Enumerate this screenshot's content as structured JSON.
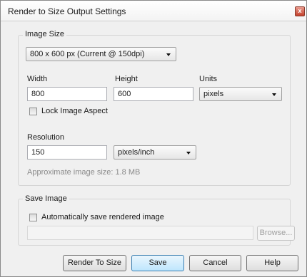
{
  "window": {
    "title": "Render to Size Output Settings",
    "close_glyph": "x"
  },
  "image_size": {
    "group_label": "Image Size",
    "preset_selected": "800 x 600 px (Current @ 150dpi)",
    "width_label": "Width",
    "width_value": "800",
    "height_label": "Height",
    "height_value": "600",
    "units_label": "Units",
    "units_selected": "pixels",
    "lock_aspect_label": "Lock Image Aspect",
    "lock_aspect_checked": false,
    "resolution_label": "Resolution",
    "resolution_value": "150",
    "resolution_unit_selected": "pixels/inch",
    "approx_size_text": "Approximate image size: 1.8 MB"
  },
  "save_image": {
    "group_label": "Save Image",
    "auto_save_label": "Automatically save rendered image",
    "auto_save_checked": false,
    "path_value": "",
    "browse_label": "Browse..."
  },
  "buttons": {
    "render_to_size": "Render To Size",
    "save": "Save",
    "cancel": "Cancel",
    "help": "Help"
  },
  "icons": {
    "close": "close-icon",
    "dropdown": "chevron-down-icon"
  }
}
